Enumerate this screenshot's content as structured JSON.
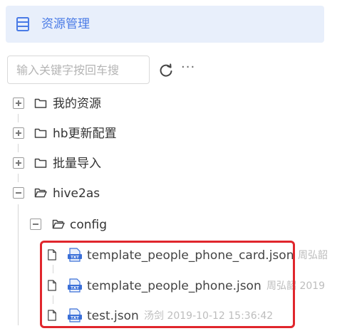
{
  "header": {
    "title": "资源管理",
    "accent_color": "#4a7be6",
    "icon": "menu-list-icon"
  },
  "search": {
    "placeholder": "输入关键字按回车搜"
  },
  "toolbar": {
    "refresh_icon": "refresh-icon",
    "more_label": "···"
  },
  "tree": {
    "nodes": [
      {
        "label": "我的资源",
        "state": "collapsed"
      },
      {
        "label": "hb更新配置",
        "state": "collapsed"
      },
      {
        "label": "批量导入",
        "state": "collapsed"
      },
      {
        "label": "hive2as",
        "state": "expanded",
        "children": [
          {
            "label": "config",
            "state": "expanded",
            "files": [
              {
                "name": "template_people_phone_card.json",
                "meta": "周弘韶"
              },
              {
                "name": "template_people_phone.json",
                "meta": "周弘韶 2019"
              },
              {
                "name": "test.json",
                "meta": "汤剑 2019-10-12 15:36:42"
              }
            ]
          }
        ]
      }
    ]
  },
  "highlight_color": "#e0262c"
}
